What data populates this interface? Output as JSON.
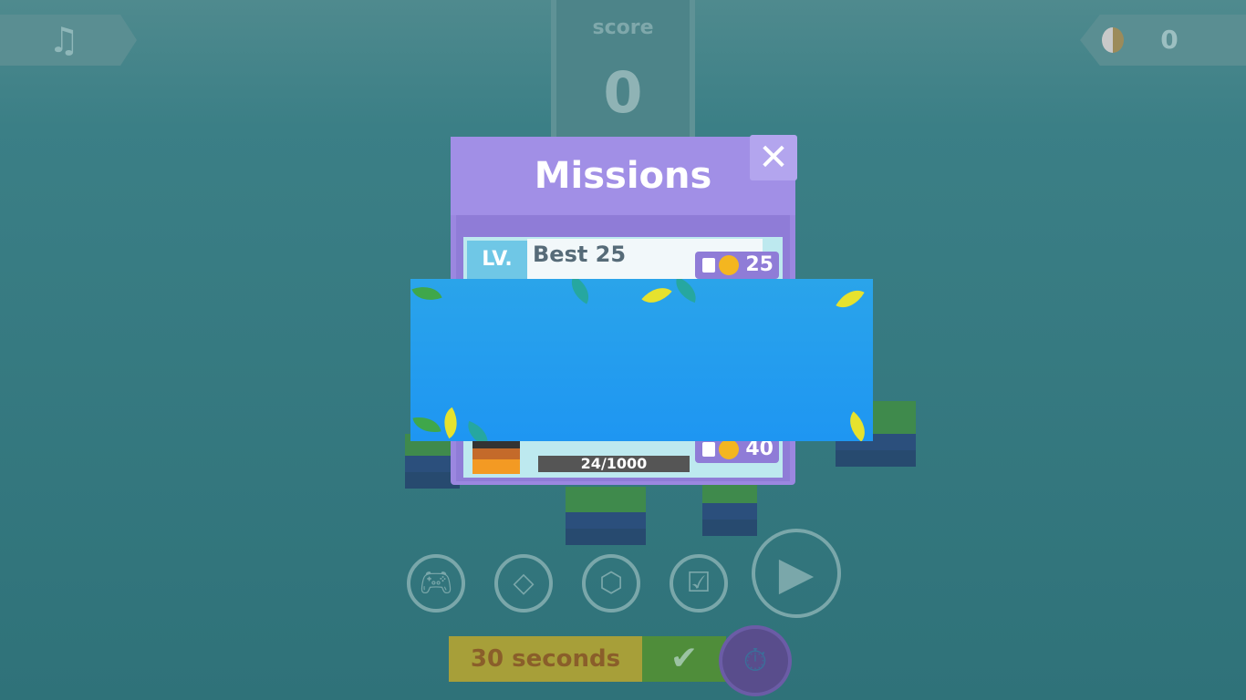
{
  "hud": {
    "music_icon": "music-note-icon",
    "score_label": "score",
    "score_value": "0",
    "coins_icon": "coin-icon",
    "coins_value": "0"
  },
  "missions_dialog": {
    "title": "Missions",
    "close_icon": "close-icon",
    "close_glyph": "✕",
    "missions": [
      {
        "level_label": "LV.",
        "title": "Best 25",
        "reward": "25",
        "reward_icon": "coin-icon"
      },
      {
        "progress": "24/1000",
        "reward": "40",
        "reward_icon": "coin-icon"
      }
    ]
  },
  "bottom_bar": {
    "buttons": [
      "gamepad-icon",
      "block-icon",
      "cube-character-icon",
      "clipboard-check-icon"
    ],
    "play_icon": "play-icon",
    "timer_text": "30 seconds",
    "check_icon": "checkmark-icon",
    "stopwatch_icon": "stopwatch-icon"
  },
  "colors": {
    "background": "#2f7279",
    "dialog": "#9b87e0",
    "ad_banner": "#1e96f2"
  }
}
